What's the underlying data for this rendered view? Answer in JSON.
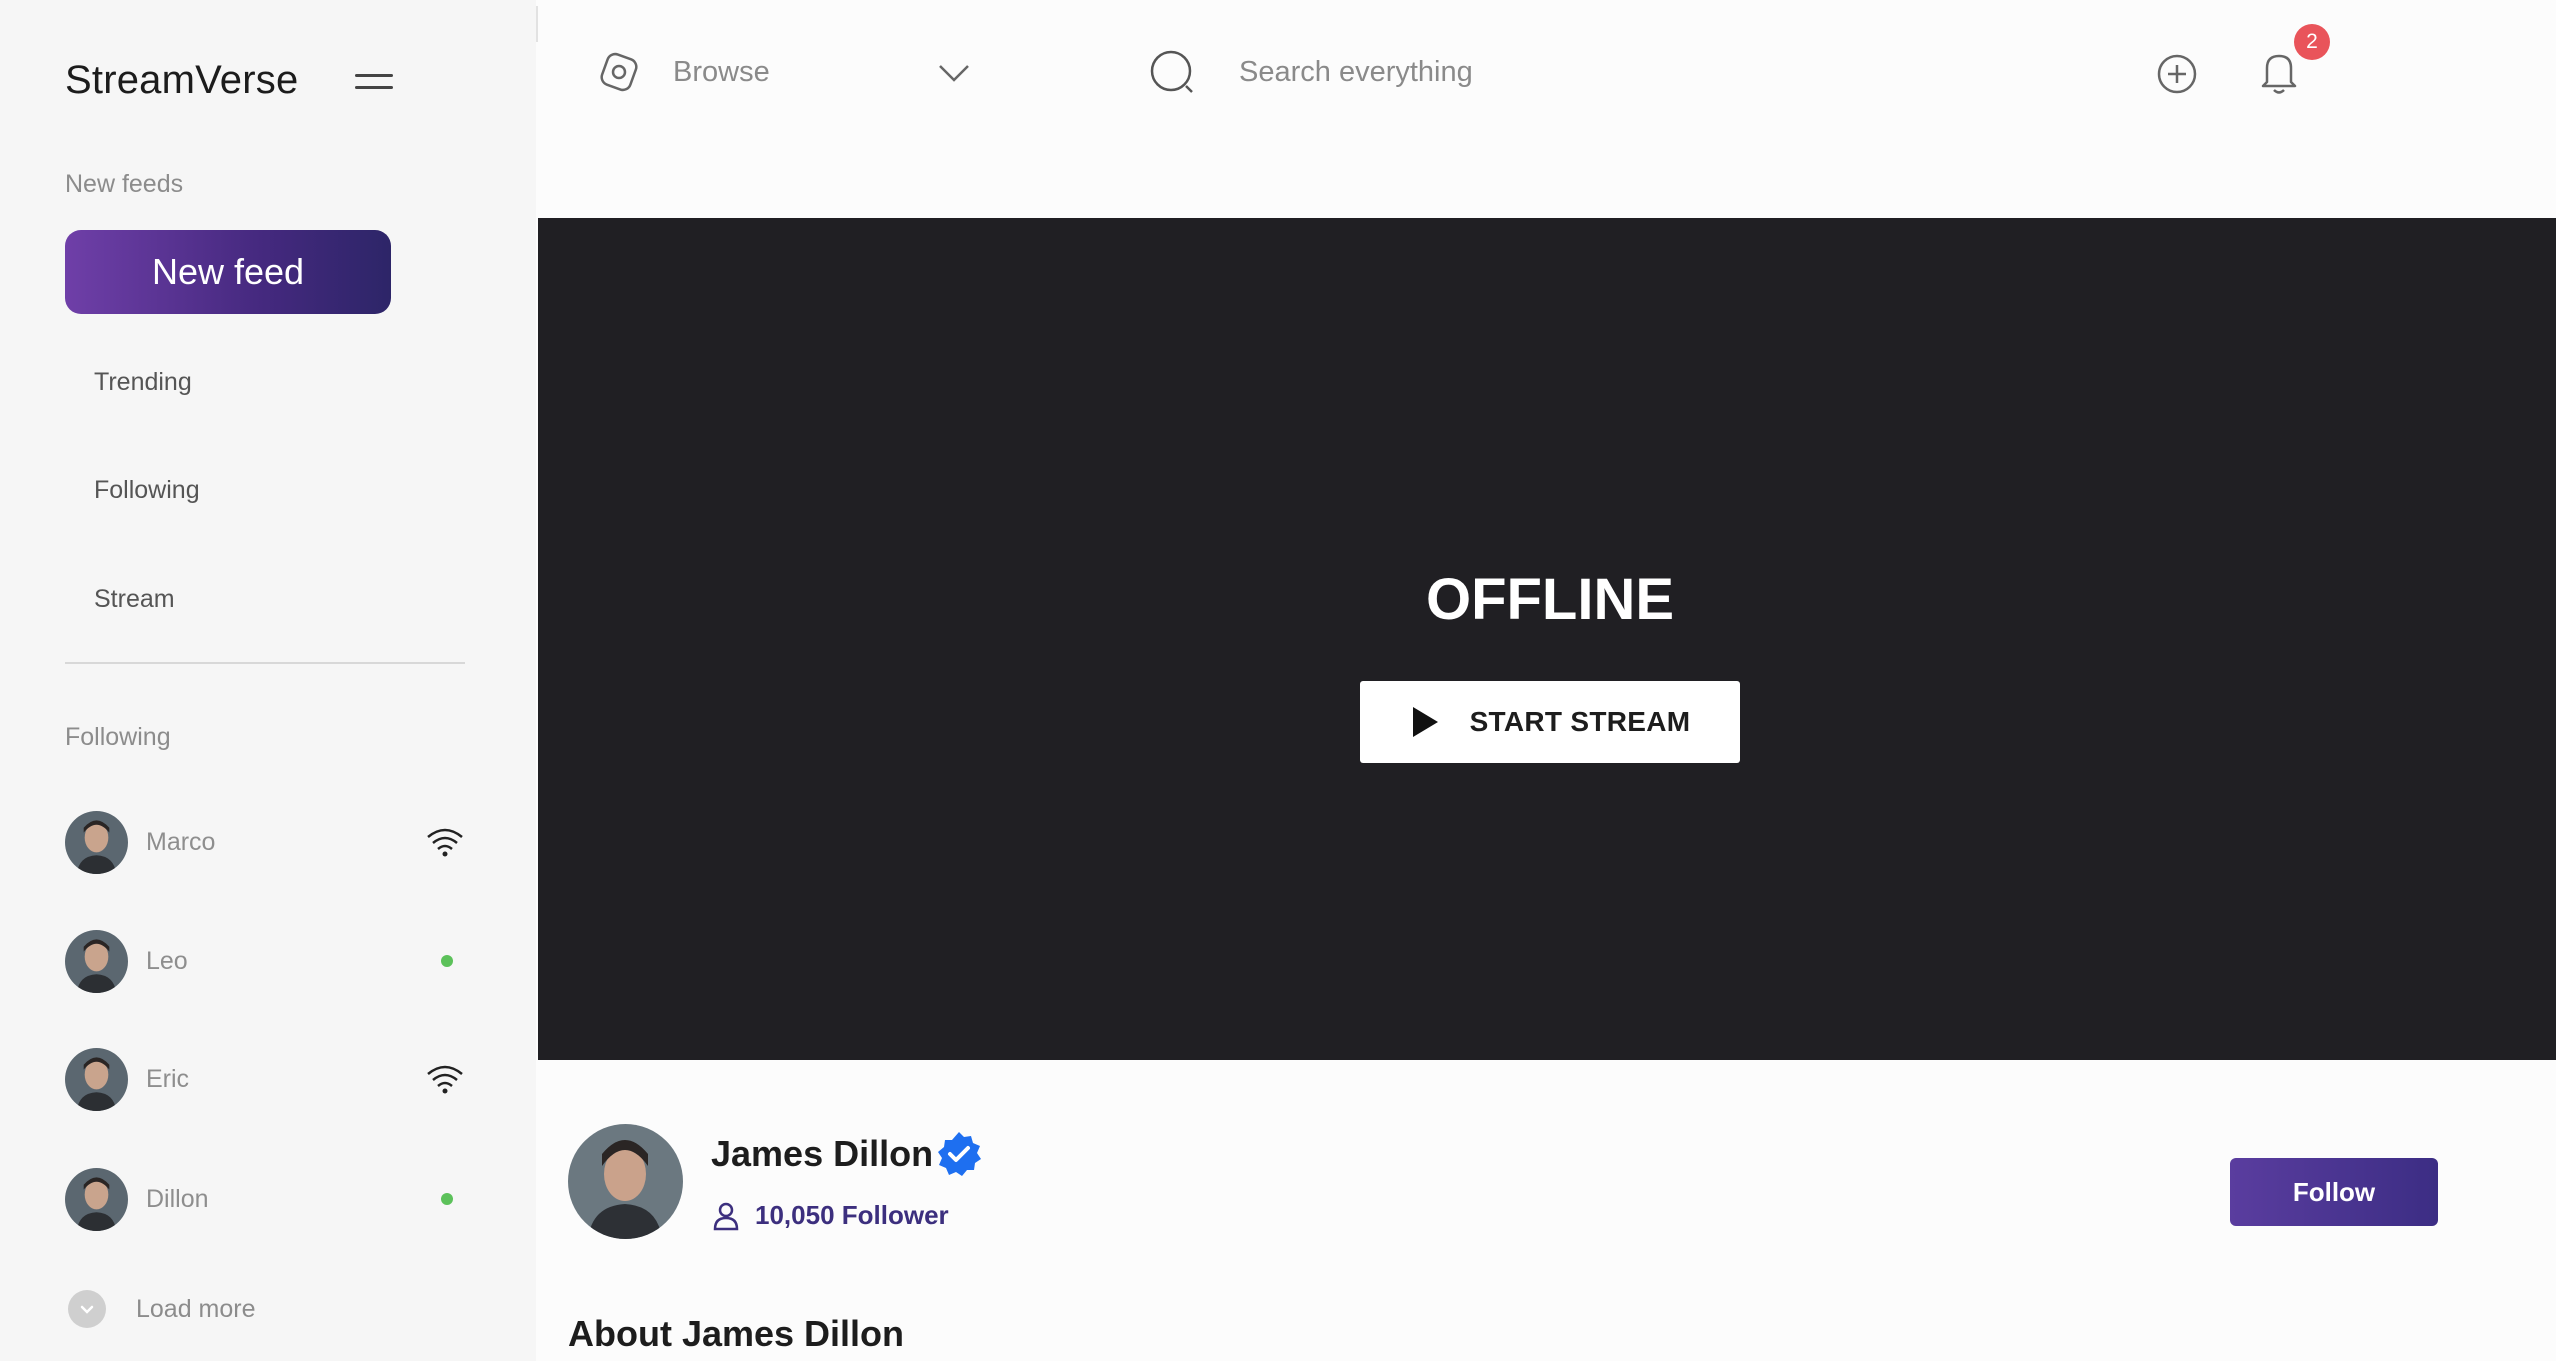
{
  "app": {
    "title": "StreamVerse"
  },
  "sidebar": {
    "new_feeds_label": "New feeds",
    "new_feed_button": "New feed",
    "nav": [
      {
        "label": "Trending"
      },
      {
        "label": "Following"
      },
      {
        "label": "Stream"
      }
    ],
    "following_label": "Following",
    "following": [
      {
        "name": "Marco",
        "status": "wifi-icon"
      },
      {
        "name": "Leo",
        "status": "online-dot"
      },
      {
        "name": "Eric",
        "status": "wifi-icon"
      },
      {
        "name": "Dillon",
        "status": "online-dot"
      }
    ],
    "load_more": "Load more"
  },
  "topbar": {
    "browse_label": "Browse",
    "search_placeholder": "Search everything",
    "notification_count": "2"
  },
  "player": {
    "status_text": "OFFLINE",
    "start_stream_label": "START STREAM"
  },
  "profile": {
    "name": "James Dillon",
    "followers": "10,050 Follower",
    "follow_button": "Follow",
    "about_title": "About James Dillon"
  },
  "colors": {
    "accent": "#4a2f8c",
    "online": "#5cc15a",
    "badge": "#e9545a",
    "verified": "#1e6ff0",
    "player_bg": "#201f23"
  }
}
